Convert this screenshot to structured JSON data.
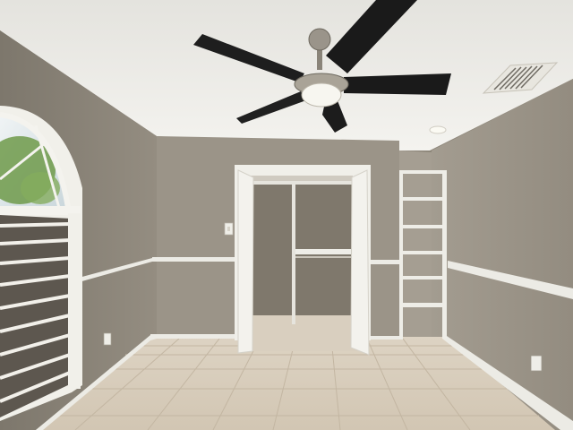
{
  "scene": {
    "colors": {
      "ceiling": "#efeeea",
      "wall_left": "#8b8579",
      "wall_back": "#9a9386",
      "wall_right": "#9b9488",
      "closet_interior": "#7f786c",
      "trim": "#ecebe5",
      "floor": "#d8cdbb",
      "fan_blade": "#1a1a1a",
      "fan_metal": "#9a948a",
      "window_sky": "#dfe6ea",
      "window_tree": "#6f9a4a"
    }
  }
}
